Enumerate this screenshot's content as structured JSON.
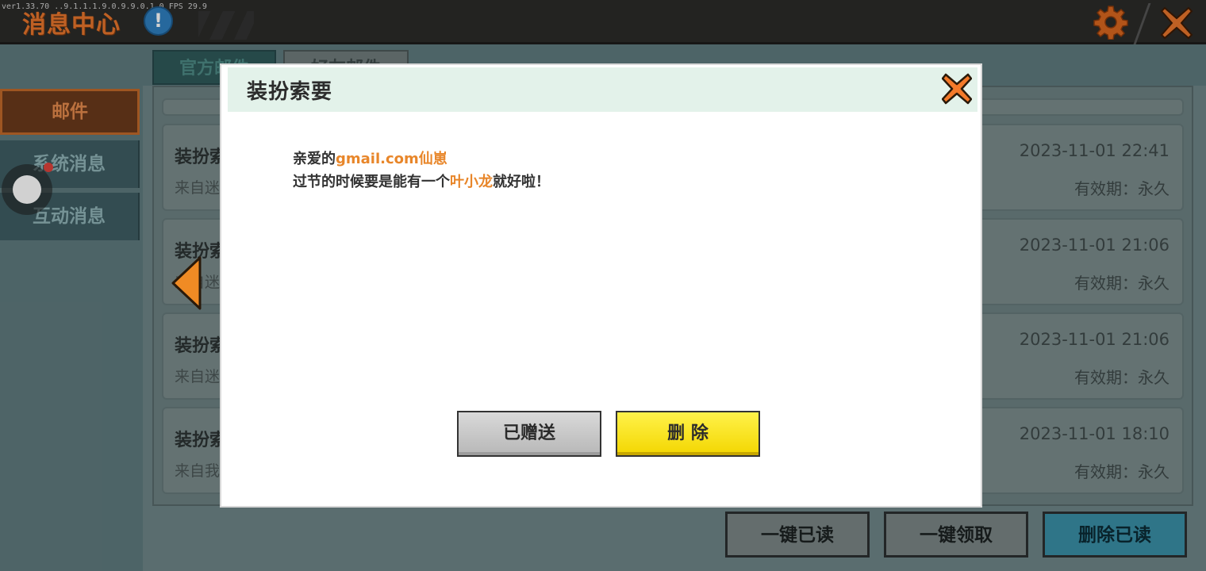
{
  "debug_text": "ver1.33.70 ..9.1.1.1.9.0.9.9.0.1.0 FPS 29.9",
  "header": {
    "title": "消息中心",
    "info_symbol": "!"
  },
  "sidebar": {
    "items": [
      {
        "label": "邮件",
        "active": true
      },
      {
        "label": "系统消息",
        "active": false,
        "has_notification": true
      },
      {
        "label": "互动消息",
        "active": false
      }
    ]
  },
  "mail_tabs": [
    {
      "label": "官方邮件",
      "active": true
    },
    {
      "label": "好友邮件",
      "active": false
    }
  ],
  "mail_list": [
    {
      "title": "装扮索要",
      "sender": "来自迷",
      "date": "2023-11-01 22:41",
      "validity": "有效期：永久"
    },
    {
      "title": "装扮索要",
      "sender": "来自迷",
      "date": "2023-11-01 21:06",
      "validity": "有效期：永久"
    },
    {
      "title": "装扮索要",
      "sender": "来自迷",
      "date": "2023-11-01 21:06",
      "validity": "有效期：永久"
    },
    {
      "title": "装扮索要",
      "sender": "来自我",
      "date": "2023-11-01 18:10",
      "validity": "有效期：永久"
    }
  ],
  "bottom_actions": {
    "mark_all_read": "一键已读",
    "claim_all": "一键领取",
    "delete_read": "删除已读"
  },
  "dialog": {
    "title": "装扮索要",
    "line1_prefix": "亲爱的",
    "line1_name": "gmail.com仙崽",
    "line2_prefix": "过节的时候要是能有一个",
    "line2_item": "叶小龙",
    "line2_suffix": "就好啦！",
    "gifted_label": "已赠送",
    "delete_label": "删 除"
  },
  "colors": {
    "accent_orange": "#e8762c",
    "highlight": "#e8862a",
    "delete_yellow": "#f3d600",
    "blue_button": "#3a8fa7"
  }
}
